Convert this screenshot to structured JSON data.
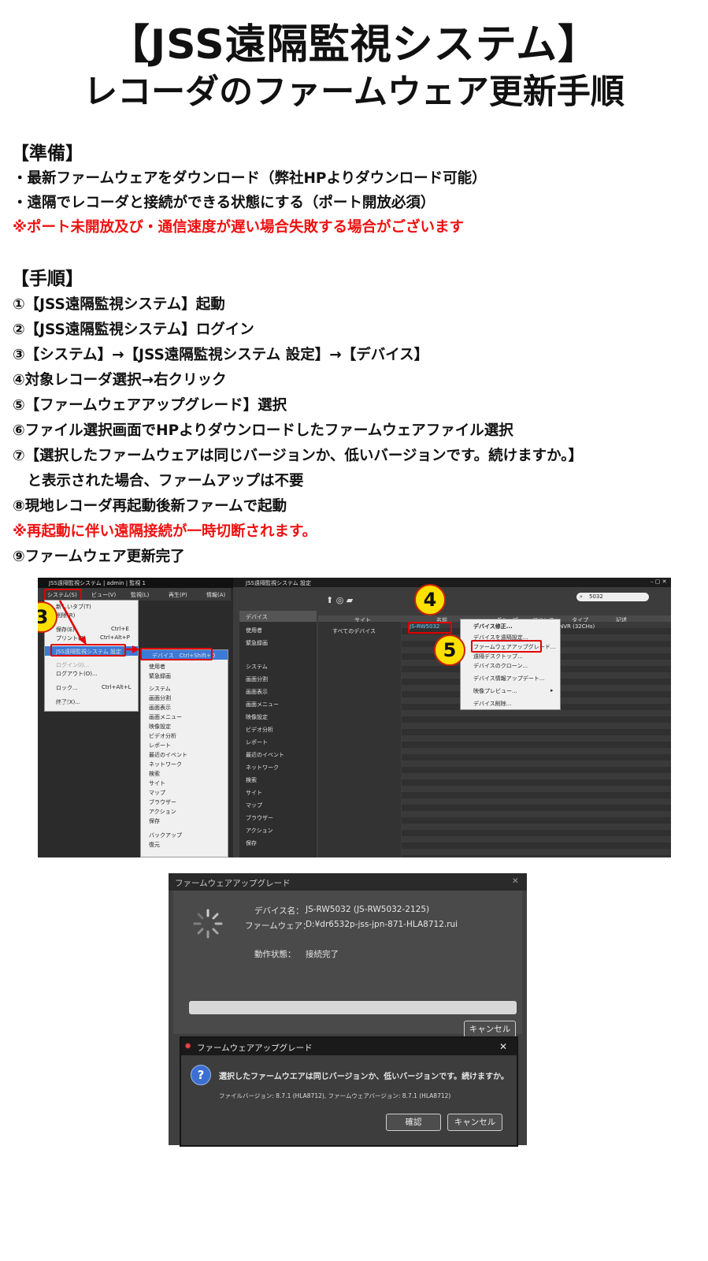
{
  "header": {
    "title": "【JSS遠隔監視システム】",
    "subtitle": "レコーダのファームウェア更新手順"
  },
  "prep": {
    "heading": "【準備】",
    "items": [
      "・最新ファームウェアをダウンロード（弊社HPよりダウンロード可能）",
      "・遠隔でレコーダと接続ができる状態にする（ポート開放必須）"
    ],
    "warning": "※ポート未開放及び・通信速度が遅い場合失敗する場合がございます"
  },
  "steps": {
    "heading": "【手順】",
    "items": [
      "①【JSS遠隔監視システム】起動",
      "②【JSS遠隔監視システム】ログイン",
      "③【システム】→【JSS遠隔監視システム 設定】→【デバイス】",
      "④対象レコーダ選択→右クリック",
      "⑤【ファームウェアアップグレード】選択",
      "⑥ファイル選択画面でHPよりダウンロードしたファームウェアファイル選択",
      "⑦【選択したファームウェアは同じバージョンか、低いバージョンです。続けますか。】",
      "　と表示された場合、ファームアップは不要",
      "⑧現地レコーダ再起動後新ファームで起動"
    ],
    "warning": "※再起動に伴い遠隔接続が一時切断されます。",
    "last": "⑨ファームウェア更新完了"
  },
  "shot1": {
    "left_title": "JSS遠隔監視システム | admin | 監視 1",
    "menubar": [
      "システム(S)",
      "ビュー(V)",
      "監視(L)",
      "再生(P)",
      "情報(A)"
    ],
    "dropdown": [
      {
        "label": "新しいタブ(T)",
        "shortcut": ""
      },
      {
        "label": "削除(R)",
        "shortcut": ""
      },
      {
        "label": "保存(E)",
        "shortcut": "Ctrl+E"
      },
      {
        "label": "プリント(P)",
        "shortcut": "Ctrl+Alt+P"
      },
      {
        "label": "JSS遠隔監視システム 設定",
        "shortcut": ""
      },
      {
        "label": "ログイン(I)...",
        "shortcut": ""
      },
      {
        "label": "ログアウト(O)...",
        "shortcut": ""
      },
      {
        "label": "ロック...",
        "shortcut": "Ctrl+Alt+L"
      },
      {
        "label": "終了(X)...",
        "shortcut": ""
      }
    ],
    "hdd": "HDP",
    "submenu": [
      "デバイス　Ctrl+Shift+D",
      "使用者",
      "緊急録画",
      "システム",
      "画面分割",
      "画面表示",
      "画面メニュー",
      "映像設定",
      "ビデオ分析",
      "レポート",
      "最近のイベント",
      "ネットワーク",
      "検索",
      "サイト",
      "マップ",
      "ブラウザー",
      "アクション",
      "保存",
      "バックアップ",
      "復元"
    ],
    "right_title": "JSS遠隔監視システム 設定",
    "search_value": "5032",
    "nav": [
      "デバイス",
      "使用者",
      "緊急録画",
      "システム",
      "画面分割",
      "画面表示",
      "画面メニュー",
      "映像設定",
      "ビデオ分析",
      "レポート",
      "最近のイベント",
      "ネットワーク",
      "検索",
      "サイト",
      "マップ",
      "ブラウザー",
      "アクション",
      "保存"
    ],
    "columns": [
      "サイト",
      "名前",
      "グループ",
      "アドレス",
      "タイプ",
      "記述"
    ],
    "site_all": "すべてのデバイス",
    "device": "JS-RW5032",
    "device_type": "NVR (32CHs)",
    "context": [
      "デバイス修正...",
      "デバイスを遠隔設定...",
      "ファームウェアアップグレード...",
      "遠隔デスクトップ...",
      "デバイスのクローン...",
      "デバイス情報アップデート...",
      "映像プレビュー...",
      "デバイス削除..."
    ],
    "badges": [
      "3",
      "4",
      "5"
    ]
  },
  "shot2": {
    "title": "ファームウェアアップグレード",
    "device_label": "デバイス名：",
    "device_value": "JS-RW5032 (JS-RW5032-2125)",
    "fw_label": "ファームウェア：",
    "fw_value": "D:¥dr6532p-jss-jpn-871-HLA8712.rui",
    "state_label": "動作状態：",
    "state_value": "接続完了",
    "cancel": "キャンセル",
    "dialog_title": "ファームウェアアップグレード",
    "dialog_msg": "選択したファームウエアは同じバージョンか、低いバージョンです。続けますか。",
    "dialog_sub": "ファイルバージョン: 8.7.1 (HLA8712), ファームウェアバージョン: 8.7.1 (HLA8712)",
    "ok": "確認",
    "cancel2": "キャンセル"
  }
}
